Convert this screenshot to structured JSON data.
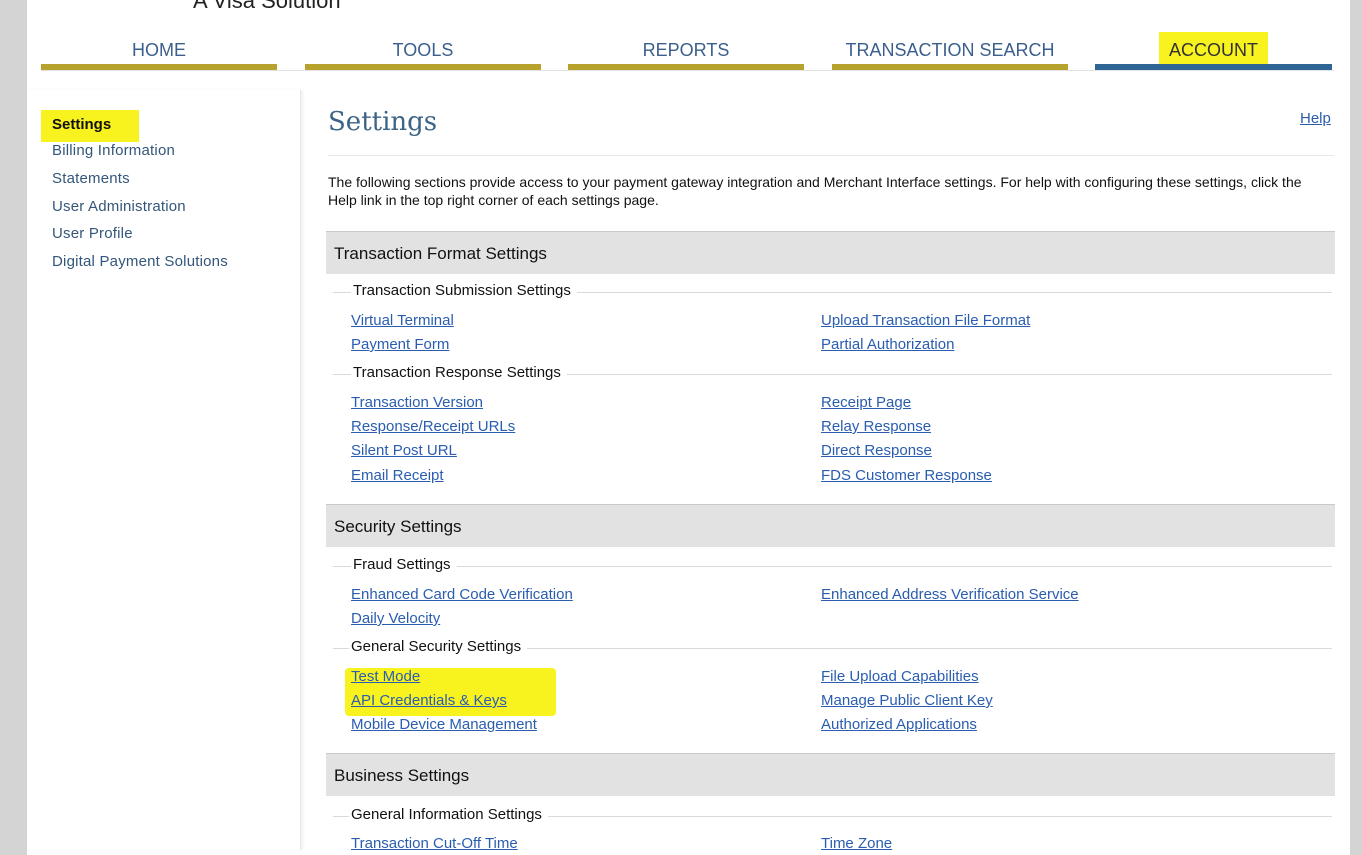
{
  "brand": {
    "text": "A Visa Solution"
  },
  "nav": {
    "tabs": [
      {
        "label": "HOME"
      },
      {
        "label": "TOOLS"
      },
      {
        "label": "REPORTS"
      },
      {
        "label": "TRANSACTION SEARCH"
      },
      {
        "label": "ACCOUNT"
      }
    ],
    "active": "ACCOUNT"
  },
  "sidebar": {
    "active": "Settings",
    "items": [
      {
        "label": "Billing Information"
      },
      {
        "label": "Statements"
      },
      {
        "label": "User Administration"
      },
      {
        "label": "User Profile"
      },
      {
        "label": "Digital Payment Solutions"
      }
    ]
  },
  "main": {
    "title": "Settings",
    "help": "Help",
    "intro": "The following sections provide access to your payment gateway integration and Merchant Interface settings. For help with configuring these settings, click the Help link in the top right corner of each settings page.",
    "sections": [
      {
        "title": "Transaction Format Settings",
        "groups": [
          {
            "title": "Transaction Submission Settings",
            "left": [
              "Virtual Terminal",
              "Payment Form"
            ],
            "right": [
              "Upload Transaction File Format",
              "Partial Authorization"
            ]
          },
          {
            "title": "Transaction Response Settings",
            "left": [
              "Transaction Version",
              "Response/Receipt URLs",
              "Silent Post URL",
              "Email Receipt"
            ],
            "right": [
              "Receipt Page",
              "Relay Response",
              "Direct Response",
              "FDS Customer Response"
            ]
          }
        ]
      },
      {
        "title": "Security Settings",
        "groups": [
          {
            "title": "Fraud Settings",
            "left": [
              "Enhanced Card Code Verification",
              "Daily Velocity"
            ],
            "right": [
              "Enhanced Address Verification Service"
            ]
          },
          {
            "title": "General Security Settings",
            "left": [
              "Test Mode",
              "API Credentials & Keys",
              "Mobile Device Management"
            ],
            "right": [
              "File Upload Capabilities",
              "Manage Public Client Key",
              "Authorized Applications"
            ]
          }
        ]
      },
      {
        "title": "Business Settings",
        "groups": [
          {
            "title": "General Information Settings",
            "left": [
              "Transaction Cut-Off Time"
            ],
            "right": [
              "Time Zone"
            ]
          }
        ]
      }
    ]
  },
  "colors": {
    "highlight": "#f8f21f",
    "tab_bar": "#b6a22c",
    "active_tab_bar": "#2d6694",
    "link": "#2a5db0",
    "title": "#3d6385"
  }
}
